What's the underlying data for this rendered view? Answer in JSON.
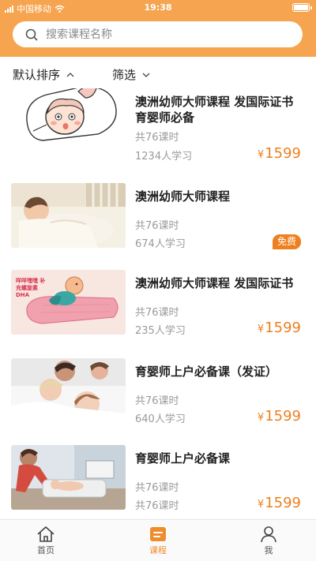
{
  "status_bar": {
    "carrier": "中国移动",
    "time": "19:38"
  },
  "search": {
    "placeholder": "搜索课程名称"
  },
  "filters": {
    "sort_label": "默认排序",
    "filter_label": "筛选"
  },
  "courses": [
    {
      "title": "澳洲幼师大师课程 发国际证书 育婴师必备",
      "lessons": "共76课时",
      "students": "1234人学习",
      "price_symbol": "¥",
      "price": "1599"
    },
    {
      "title": "澳洲幼师大师课程",
      "lessons": "共76课时",
      "students": "674人学习",
      "badge": "免费"
    },
    {
      "title": "澳洲幼师大师课程 发国际证书",
      "lessons": "共76课时",
      "students": "235人学习",
      "price_symbol": "¥",
      "price": "1599",
      "thumb_caption": "咩咩嘿嘿 补充螺旋素DHA"
    },
    {
      "title": "育婴师上户必备课（发证）",
      "lessons": "共76课时",
      "students": "640人学习",
      "price_symbol": "¥",
      "price": "1599"
    },
    {
      "title": "育婴师上户必备课",
      "lessons": "共76课时",
      "students": "共76课时",
      "price_symbol": "¥",
      "price": "1599"
    }
  ],
  "tab_bar": {
    "tabs": [
      {
        "label": "首页",
        "icon": "home-icon"
      },
      {
        "label": "课程",
        "icon": "course-icon"
      },
      {
        "label": "我",
        "icon": "profile-icon"
      }
    ]
  },
  "colors": {
    "header": "#f6a44f",
    "accent": "#ef7f1f",
    "muted": "#9a9a9a"
  }
}
